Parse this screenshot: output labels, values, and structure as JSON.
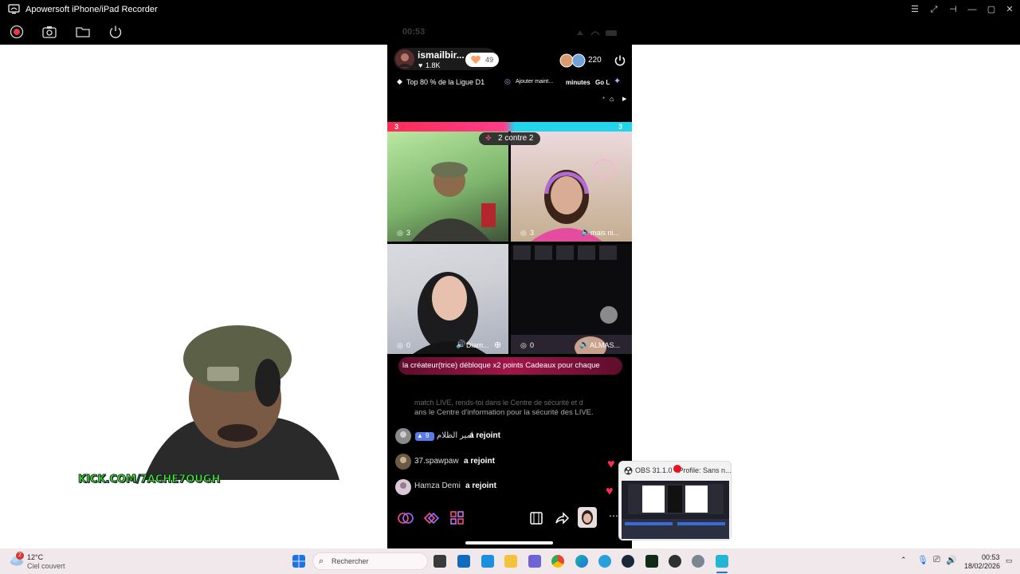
{
  "window": {
    "title": "Apowersoft iPhone/iPad Recorder"
  },
  "phone": {
    "status_time": "00:53",
    "host_name": "ismailbir...",
    "host_likes": "1.8K",
    "heart_count": "49",
    "viewer_count": "220",
    "info_bar": {
      "ranking": "Top 80 % de la Ligue D1",
      "add_label": "Ajouter maint...",
      "ticker_minutes": "minutes",
      "ticker_go": "Go L"
    },
    "battle": {
      "left_score": "3",
      "right_score": "3",
      "mode": "2 contre 2"
    },
    "tiles": [
      {
        "score": "3"
      },
      {
        "score": "3",
        "caption": "mais ni..."
      },
      {
        "score": "0",
        "caption": "Diam..."
      },
      {
        "score": "0",
        "caption": "ALMAS..."
      }
    ],
    "banner": "la créateur(trice) débloque x2 points Cadeaux pour chaque",
    "system_msg_line1": "match LIVE, rends-toi dans le Centre de sécurité et d",
    "system_msg_line2": "ans le Centre d'information pour la sécurité des LIVE.",
    "joins": [
      {
        "level": "9",
        "name": "امير الظلام",
        "action": "a rejoint"
      },
      {
        "name": "37.spawpaw",
        "action": "a rejoint"
      },
      {
        "name": "Hamza Demi",
        "action": "a rejoint"
      }
    ]
  },
  "webcam": {
    "overlay_text": "KICK.COM/7ACHE7OUGH"
  },
  "obs_popup": {
    "title": "OBS 31.1.0 - Profile: Sans n..."
  },
  "taskbar": {
    "weather": {
      "badge": "2",
      "temp": "12°C",
      "condition": "Ciel couvert"
    },
    "search_placeholder": "Rechercher",
    "clock_time": "00:53",
    "clock_date": "18/02/2026",
    "icons": [
      "windows-start-icon",
      "search-icon",
      "task-view-icon",
      "store-icon",
      "outlook-icon",
      "file-explorer-icon",
      "teams-icon",
      "chrome-icon",
      "edge-icon",
      "telegram-icon",
      "steam-icon",
      "terminal-icon",
      "obs-icon",
      "settings-icon",
      "recorder-icon"
    ]
  },
  "colors": {
    "accent_pink": "#fe2c55",
    "accent_cyan": "#20d5ec",
    "banner_bg": "#7a1238"
  }
}
